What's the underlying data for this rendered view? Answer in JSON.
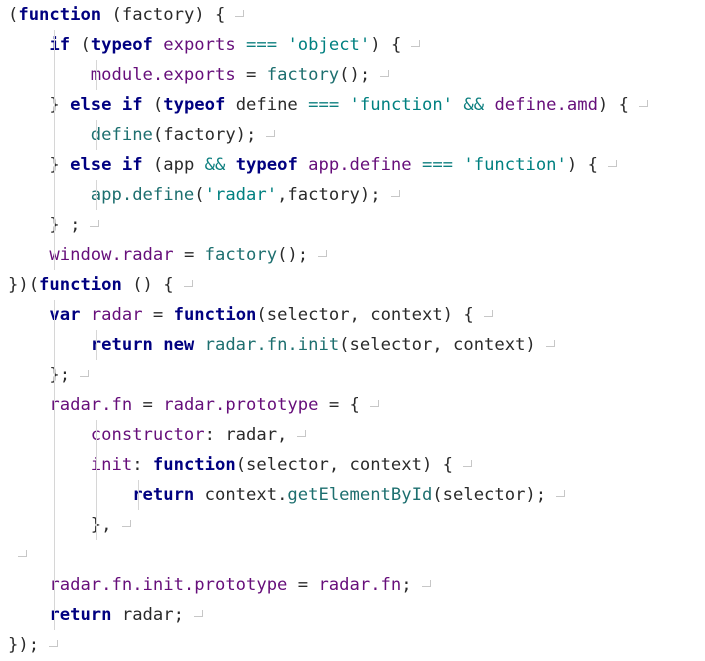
{
  "editor": {
    "lines": [
      [
        [
          "(",
          "p"
        ],
        [
          "function",
          "kw"
        ],
        [
          " (factory) {",
          "p"
        ]
      ],
      [
        [
          "    ",
          "ws"
        ],
        [
          "if",
          "kw"
        ],
        [
          " (",
          "p"
        ],
        [
          "typeof",
          "kw"
        ],
        [
          " exports ",
          "var"
        ],
        [
          "===",
          "op"
        ],
        [
          " ",
          "p"
        ],
        [
          "'object'",
          "str"
        ],
        [
          ") {",
          "p"
        ]
      ],
      [
        [
          "        ",
          "ws"
        ],
        [
          "module.exports",
          "var"
        ],
        [
          " = ",
          "p"
        ],
        [
          "factory",
          "fn"
        ],
        [
          "();",
          "p"
        ]
      ],
      [
        [
          "    ",
          "ws"
        ],
        [
          "} ",
          "p"
        ],
        [
          "else if",
          "kw"
        ],
        [
          " (",
          "p"
        ],
        [
          "typeof",
          "kw"
        ],
        [
          " define ",
          "p"
        ],
        [
          "===",
          "op"
        ],
        [
          " ",
          "p"
        ],
        [
          "'function'",
          "str"
        ],
        [
          " ",
          "p"
        ],
        [
          "&&",
          "op"
        ],
        [
          " define.amd",
          "var"
        ],
        [
          ") {",
          "p"
        ]
      ],
      [
        [
          "        ",
          "ws"
        ],
        [
          "define",
          "fn"
        ],
        [
          "(factory);",
          "p"
        ]
      ],
      [
        [
          "    ",
          "ws"
        ],
        [
          "} ",
          "p"
        ],
        [
          "else if",
          "kw"
        ],
        [
          " (app ",
          "p"
        ],
        [
          "&&",
          "op"
        ],
        [
          " ",
          "p"
        ],
        [
          "typeof",
          "kw"
        ],
        [
          " app.define ",
          "var"
        ],
        [
          "===",
          "op"
        ],
        [
          " ",
          "p"
        ],
        [
          "'function'",
          "str"
        ],
        [
          ") {",
          "p"
        ]
      ],
      [
        [
          "        ",
          "ws"
        ],
        [
          "app.define",
          "fn"
        ],
        [
          "(",
          "p"
        ],
        [
          "'radar'",
          "str"
        ],
        [
          ",factory);",
          "p"
        ]
      ],
      [
        [
          "    ",
          "ws"
        ],
        [
          "} ;",
          "p"
        ]
      ],
      [
        [
          "    ",
          "ws"
        ],
        [
          "window.radar",
          "var"
        ],
        [
          " = ",
          "p"
        ],
        [
          "factory",
          "fn"
        ],
        [
          "();",
          "p"
        ]
      ],
      [
        [
          "})(",
          "p"
        ],
        [
          "function",
          "kw"
        ],
        [
          " () {",
          "p"
        ]
      ],
      [
        [
          "    ",
          "ws"
        ],
        [
          "var",
          "kw"
        ],
        [
          " ",
          "p"
        ],
        [
          "radar",
          "var"
        ],
        [
          " = ",
          "p"
        ],
        [
          "function",
          "kw"
        ],
        [
          "(selector, context) {",
          "p"
        ]
      ],
      [
        [
          "        ",
          "ws"
        ],
        [
          "return new",
          "kw"
        ],
        [
          " ",
          "p"
        ],
        [
          "radar.fn.init",
          "fn"
        ],
        [
          "(selector, context)",
          "p"
        ]
      ],
      [
        [
          "    ",
          "ws"
        ],
        [
          "};",
          "p"
        ]
      ],
      [
        [
          "    ",
          "ws"
        ],
        [
          "radar.fn",
          "var"
        ],
        [
          " = ",
          "p"
        ],
        [
          "radar.prototype",
          "var"
        ],
        [
          " = {",
          "p"
        ]
      ],
      [
        [
          "        ",
          "ws"
        ],
        [
          "constructor",
          "var"
        ],
        [
          ": radar,",
          "p"
        ]
      ],
      [
        [
          "        ",
          "ws"
        ],
        [
          "init",
          "var"
        ],
        [
          ": ",
          "p"
        ],
        [
          "function",
          "kw"
        ],
        [
          "(selector, context) {",
          "p"
        ]
      ],
      [
        [
          "            ",
          "ws"
        ],
        [
          "return",
          "kw"
        ],
        [
          " context.",
          "p"
        ],
        [
          "getElementById",
          "fn"
        ],
        [
          "(selector);",
          "p"
        ]
      ],
      [
        [
          "        ",
          "ws"
        ],
        [
          "},",
          "p"
        ]
      ],
      [],
      [
        [
          "    ",
          "ws"
        ],
        [
          "radar.fn.init.prototype",
          "var"
        ],
        [
          " = ",
          "p"
        ],
        [
          "radar.fn",
          "var"
        ],
        [
          ";",
          "p"
        ]
      ],
      [
        [
          "    ",
          "ws"
        ],
        [
          "return",
          "kw"
        ],
        [
          " radar;",
          "p"
        ]
      ],
      [
        [
          "});",
          "p"
        ]
      ]
    ]
  }
}
